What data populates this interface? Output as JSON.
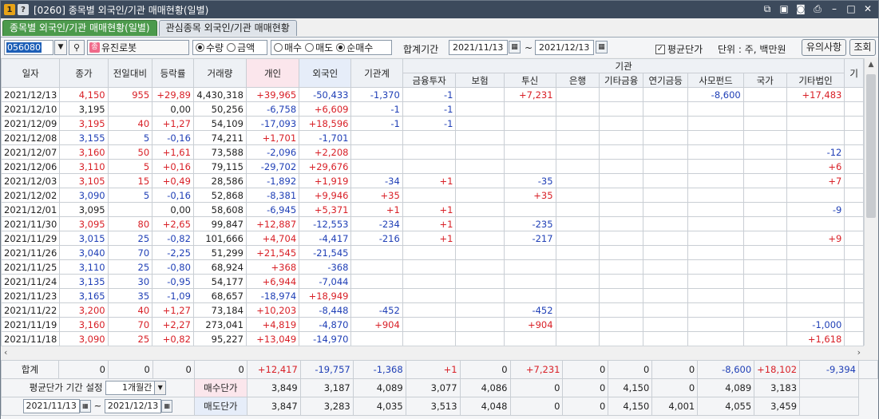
{
  "title": {
    "badge1": "1",
    "badge2": "?",
    "text": "[0260] 종목별 외국인/기관 매매현황(일별)"
  },
  "tabs": [
    {
      "label": "종목별 외국인/기관 매매현황(일별)"
    },
    {
      "label": "관심종목 외국인/기관 매매현황"
    }
  ],
  "toolbar": {
    "code": "056080",
    "stock_icon": "종",
    "stock_name": "유진로봇",
    "unit_radios": [
      "수량",
      "금액"
    ],
    "side_radios": [
      "매수",
      "매도",
      "순매수"
    ],
    "period_label": "합계기간",
    "date_from": "2021/11/13",
    "tilde": "~",
    "date_to": "2021/12/13",
    "avg_price_label": "평균단가",
    "unit_label": "단위 : 주, 백만원",
    "notice_button": "유의사항",
    "query_button": "조회"
  },
  "header": {
    "group_inst": "기관",
    "cols": [
      "일자",
      "종가",
      "전일대비",
      "등락률",
      "거래량",
      "개인",
      "외국인",
      "기관계"
    ],
    "inst_cols": [
      "금융투자",
      "보험",
      "투신",
      "은행",
      "기타금융",
      "연기금등",
      "사모펀드",
      "국가"
    ],
    "tail_cols": [
      "기타법인",
      "기"
    ]
  },
  "rows": [
    {
      "date": "2021/12/13",
      "close": "4,150",
      "chg": "955",
      "rate": "+29,89",
      "vol": "4,430,318",
      "ind": "+39,965",
      "for": "-50,433",
      "inst": "-1,370",
      "fin": "-1",
      "ins": "",
      "trust": "+7,231",
      "bank": "",
      "etcfin": "",
      "pen": "",
      "pe": "-8,600",
      "nat": "",
      "corp": "+17,483",
      "c": "up"
    },
    {
      "date": "2021/12/10",
      "close": "3,195",
      "chg": "",
      "rate": "0,00",
      "vol": "50,256",
      "ind": "-6,758",
      "for": "+6,609",
      "inst": "-1",
      "fin": "-1",
      "ins": "",
      "trust": "",
      "bank": "",
      "etcfin": "",
      "pen": "",
      "pe": "",
      "nat": "",
      "corp": "",
      "c": "flat"
    },
    {
      "date": "2021/12/09",
      "close": "3,195",
      "chg": "40",
      "rate": "+1,27",
      "vol": "54,109",
      "ind": "-17,093",
      "for": "+18,596",
      "inst": "-1",
      "fin": "-1",
      "ins": "",
      "trust": "",
      "bank": "",
      "etcfin": "",
      "pen": "",
      "pe": "",
      "nat": "",
      "corp": "",
      "c": "up"
    },
    {
      "date": "2021/12/08",
      "close": "3,155",
      "chg": "5",
      "rate": "-0,16",
      "vol": "74,211",
      "ind": "+1,701",
      "for": "-1,701",
      "inst": "",
      "fin": "",
      "ins": "",
      "trust": "",
      "bank": "",
      "etcfin": "",
      "pen": "",
      "pe": "",
      "nat": "",
      "corp": "",
      "c": "down"
    },
    {
      "date": "2021/12/07",
      "close": "3,160",
      "chg": "50",
      "rate": "+1,61",
      "vol": "73,588",
      "ind": "-2,096",
      "for": "+2,208",
      "inst": "",
      "fin": "",
      "ins": "",
      "trust": "",
      "bank": "",
      "etcfin": "",
      "pen": "",
      "pe": "",
      "nat": "",
      "corp": "-12",
      "c": "up"
    },
    {
      "date": "2021/12/06",
      "close": "3,110",
      "chg": "5",
      "rate": "+0,16",
      "vol": "79,115",
      "ind": "-29,702",
      "for": "+29,676",
      "inst": "",
      "fin": "",
      "ins": "",
      "trust": "",
      "bank": "",
      "etcfin": "",
      "pen": "",
      "pe": "",
      "nat": "",
      "corp": "+6",
      "c": "up"
    },
    {
      "date": "2021/12/03",
      "close": "3,105",
      "chg": "15",
      "rate": "+0,49",
      "vol": "28,586",
      "ind": "-1,892",
      "for": "+1,919",
      "inst": "-34",
      "fin": "+1",
      "ins": "",
      "trust": "-35",
      "bank": "",
      "etcfin": "",
      "pen": "",
      "pe": "",
      "nat": "",
      "corp": "+7",
      "c": "up"
    },
    {
      "date": "2021/12/02",
      "close": "3,090",
      "chg": "5",
      "rate": "-0,16",
      "vol": "52,868",
      "ind": "-8,381",
      "for": "+9,946",
      "inst": "+35",
      "fin": "",
      "ins": "",
      "trust": "+35",
      "bank": "",
      "etcfin": "",
      "pen": "",
      "pe": "",
      "nat": "",
      "corp": "",
      "c": "down"
    },
    {
      "date": "2021/12/01",
      "close": "3,095",
      "chg": "",
      "rate": "0,00",
      "vol": "58,608",
      "ind": "-6,945",
      "for": "+5,371",
      "inst": "+1",
      "fin": "+1",
      "ins": "",
      "trust": "",
      "bank": "",
      "etcfin": "",
      "pen": "",
      "pe": "",
      "nat": "",
      "corp": "-9",
      "c": "flat"
    },
    {
      "date": "2021/11/30",
      "close": "3,095",
      "chg": "80",
      "rate": "+2,65",
      "vol": "99,847",
      "ind": "+12,887",
      "for": "-12,553",
      "inst": "-234",
      "fin": "+1",
      "ins": "",
      "trust": "-235",
      "bank": "",
      "etcfin": "",
      "pen": "",
      "pe": "",
      "nat": "",
      "corp": "",
      "c": "up"
    },
    {
      "date": "2021/11/29",
      "close": "3,015",
      "chg": "25",
      "rate": "-0,82",
      "vol": "101,666",
      "ind": "+4,704",
      "for": "-4,417",
      "inst": "-216",
      "fin": "+1",
      "ins": "",
      "trust": "-217",
      "bank": "",
      "etcfin": "",
      "pen": "",
      "pe": "",
      "nat": "",
      "corp": "+9",
      "c": "down"
    },
    {
      "date": "2021/11/26",
      "close": "3,040",
      "chg": "70",
      "rate": "-2,25",
      "vol": "51,299",
      "ind": "+21,545",
      "for": "-21,545",
      "inst": "",
      "fin": "",
      "ins": "",
      "trust": "",
      "bank": "",
      "etcfin": "",
      "pen": "",
      "pe": "",
      "nat": "",
      "corp": "",
      "c": "down"
    },
    {
      "date": "2021/11/25",
      "close": "3,110",
      "chg": "25",
      "rate": "-0,80",
      "vol": "68,924",
      "ind": "+368",
      "for": "-368",
      "inst": "",
      "fin": "",
      "ins": "",
      "trust": "",
      "bank": "",
      "etcfin": "",
      "pen": "",
      "pe": "",
      "nat": "",
      "corp": "",
      "c": "down"
    },
    {
      "date": "2021/11/24",
      "close": "3,135",
      "chg": "30",
      "rate": "-0,95",
      "vol": "54,177",
      "ind": "+6,944",
      "for": "-7,044",
      "inst": "",
      "fin": "",
      "ins": "",
      "trust": "",
      "bank": "",
      "etcfin": "",
      "pen": "",
      "pe": "",
      "nat": "",
      "corp": "",
      "c": "down"
    },
    {
      "date": "2021/11/23",
      "close": "3,165",
      "chg": "35",
      "rate": "-1,09",
      "vol": "68,657",
      "ind": "-18,974",
      "for": "+18,949",
      "inst": "",
      "fin": "",
      "ins": "",
      "trust": "",
      "bank": "",
      "etcfin": "",
      "pen": "",
      "pe": "",
      "nat": "",
      "corp": "",
      "c": "down"
    },
    {
      "date": "2021/11/22",
      "close": "3,200",
      "chg": "40",
      "rate": "+1,27",
      "vol": "73,184",
      "ind": "+10,203",
      "for": "-8,448",
      "inst": "-452",
      "fin": "",
      "ins": "",
      "trust": "-452",
      "bank": "",
      "etcfin": "",
      "pen": "",
      "pe": "",
      "nat": "",
      "corp": "",
      "c": "up"
    },
    {
      "date": "2021/11/19",
      "close": "3,160",
      "chg": "70",
      "rate": "+2,27",
      "vol": "273,041",
      "ind": "+4,819",
      "for": "-4,870",
      "inst": "+904",
      "fin": "",
      "ins": "",
      "trust": "+904",
      "bank": "",
      "etcfin": "",
      "pen": "",
      "pe": "",
      "nat": "",
      "corp": "-1,000",
      "c": "up"
    },
    {
      "date": "2021/11/18",
      "close": "3,090",
      "chg": "25",
      "rate": "+0,82",
      "vol": "95,227",
      "ind": "+13,049",
      "for": "-14,970",
      "inst": "",
      "fin": "",
      "ins": "",
      "trust": "",
      "bank": "",
      "etcfin": "",
      "pen": "",
      "pe": "",
      "nat": "",
      "corp": "+1,618",
      "c": "up"
    }
  ],
  "summary": {
    "label": "합계",
    "values": [
      "0",
      "0",
      "0",
      "0",
      "+12,417",
      "-19,757",
      "-1,368",
      "+1",
      "0",
      "+7,231",
      "0",
      "0",
      "0",
      "-8,600",
      "+18,102",
      "-9,394"
    ]
  },
  "avg": {
    "period_label": "평균단가 기간 설정",
    "period_value": "1개월간",
    "date_from": "2021/11/13",
    "tilde": "~",
    "date_to": "2021/12/13",
    "buy_label": "매수단가",
    "sell_label": "매도단가",
    "buy_values": [
      "3,849",
      "3,187",
      "4,089",
      "3,077",
      "4,086",
      "0",
      "0",
      "4,150",
      "0",
      "4,089",
      "3,183"
    ],
    "sell_values": [
      "3,847",
      "3,283",
      "4,035",
      "3,513",
      "4,048",
      "0",
      "0",
      "4,150",
      "4,001",
      "4,055",
      "3,459"
    ]
  },
  "colors": {
    "up": "#d81f26",
    "down": "#1f3fb6",
    "tab_active": "#4c9a4c",
    "titlebar": "#3c4a5c"
  }
}
